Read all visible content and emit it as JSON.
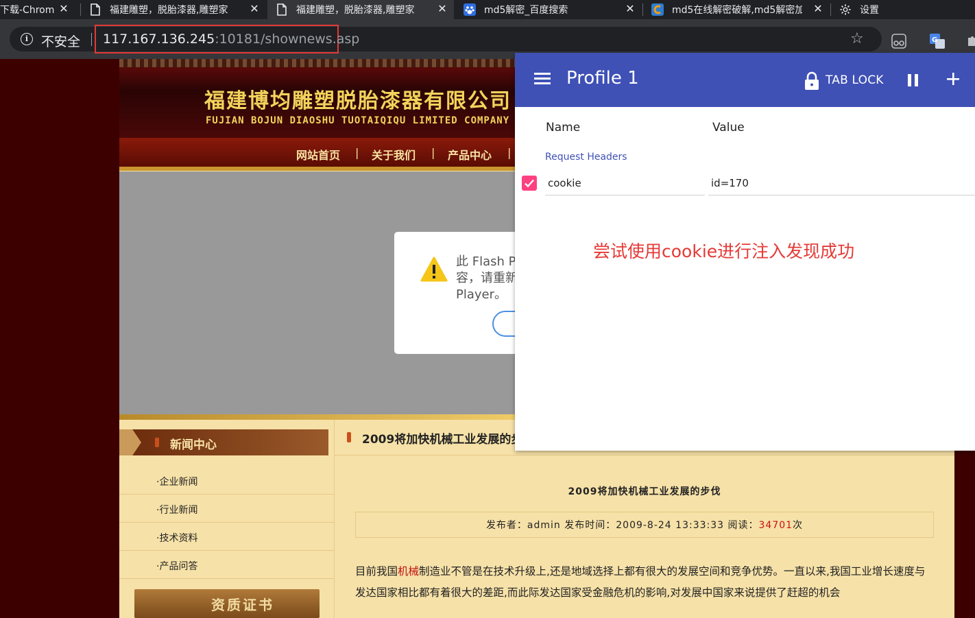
{
  "browser": {
    "tabs": [
      {
        "title": "下载-Chrom",
        "active": false,
        "icon": "page-icon"
      },
      {
        "title": "福建雕塑，脱胎漆器,雕塑家",
        "active": false,
        "icon": "page-icon"
      },
      {
        "title": "福建雕塑，脱胎漆器,雕塑家",
        "active": true,
        "icon": "page-icon"
      },
      {
        "title": "md5解密_百度搜索",
        "active": false,
        "icon": "baidu-paw-icon"
      },
      {
        "title": "md5在线解密破解,md5解密加",
        "active": false,
        "icon": "cmd5-icon"
      },
      {
        "title": "设置",
        "active": false,
        "icon": "gear-icon"
      }
    ],
    "security_label": "不安全",
    "url_host": "117.167.136.245",
    "url_rest": ":10181/shownews.asp",
    "colors": {
      "tabstrip": "#202124",
      "toolbar": "#35363a",
      "highlight_box": "#e53935"
    }
  },
  "site": {
    "company_cn": "福建博均雕塑脱胎漆器有限公司",
    "company_en": "FUJIAN BOJUN DIAOSHU  TUOTAIQIQU  LIMITED COMPANY",
    "nav": [
      "网站首页",
      "关于我们",
      "产品中心"
    ],
    "nav_sep": "|",
    "flash_notice": "此 Flash Pl\n容，请重新\nPlayer。",
    "sidebar": {
      "header": "新闻中心",
      "links": [
        "·企业新闻",
        "·行业新闻",
        "·技术资料",
        "·产品问答"
      ],
      "cert_header": "资质证书"
    },
    "article": {
      "bar_title": "2009将加快机械工业发展的步",
      "heading": "2009将加快机械工业发展的步伐",
      "meta_prefix": "发布者：admin 发布时间：2009-8-24 13:33:33 阅读：",
      "reads": "34701",
      "meta_suffix": "次",
      "body_before": "目前我国",
      "body_keyword": "机械",
      "body_after": "制造业不管是在技术升级上,还是地域选择上都有很大的发展空间和竞争优势。一直以来,我国工业增长速度与发达国家相比都有着很大的差距,而此际发达国家受金融危机的影响,对发展中国家来说提供了赶超的机会"
    },
    "colors": {
      "page_bg": "#3d0000",
      "content_bg": "#f6e1a8",
      "keyword": "#c01010"
    }
  },
  "modheader": {
    "profile": "Profile 1",
    "tab_lock": "TAB LOCK",
    "col_name": "Name",
    "col_value": "Value",
    "section": "Request Headers",
    "headers": [
      {
        "name": "cookie",
        "value": "id=170",
        "enabled": true
      }
    ],
    "annotation": "尝试使用cookie进行注入发现成功",
    "colors": {
      "bar": "#3f51b5",
      "checkbox": "#ff4081",
      "annotation": "#e53935"
    }
  }
}
